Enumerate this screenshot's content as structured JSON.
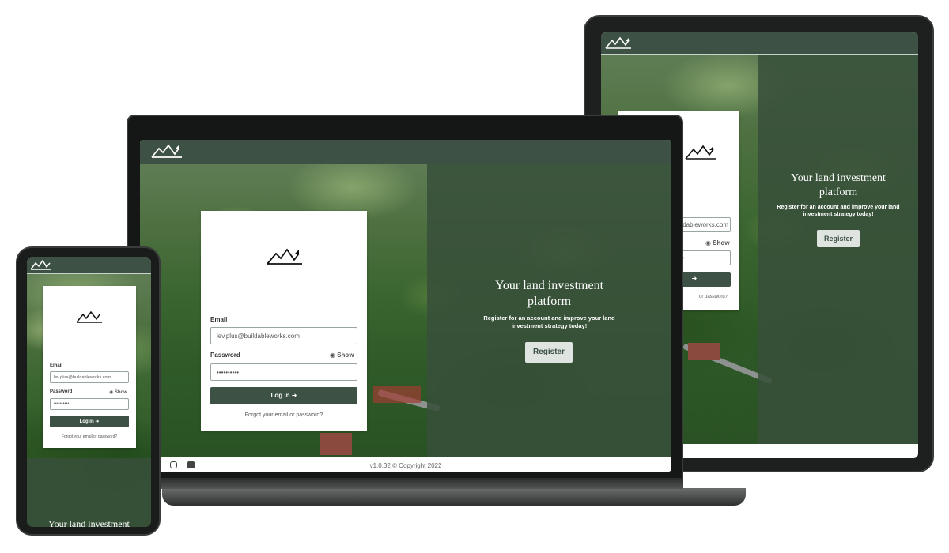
{
  "app": {
    "logo_alt": "mountain-logo",
    "brand_color": "#3d5245",
    "panel_color": "#38503a"
  },
  "login": {
    "email_label": "Email",
    "email_value": "lev.plus@buildableworks.com",
    "password_label": "Password",
    "password_value": "••••••••••",
    "show_label": "Show",
    "login_label": "Log in",
    "forgot_label": "Forgot your email or password?"
  },
  "hero": {
    "title_line1": "Your land investment",
    "title_line2": "platform",
    "subtitle_line1": "Register for an account and improve your land",
    "subtitle_line2": "investment strategy today!",
    "register_label": "Register"
  },
  "footer": {
    "version": "v1.0.32 © Copyright 2022"
  }
}
